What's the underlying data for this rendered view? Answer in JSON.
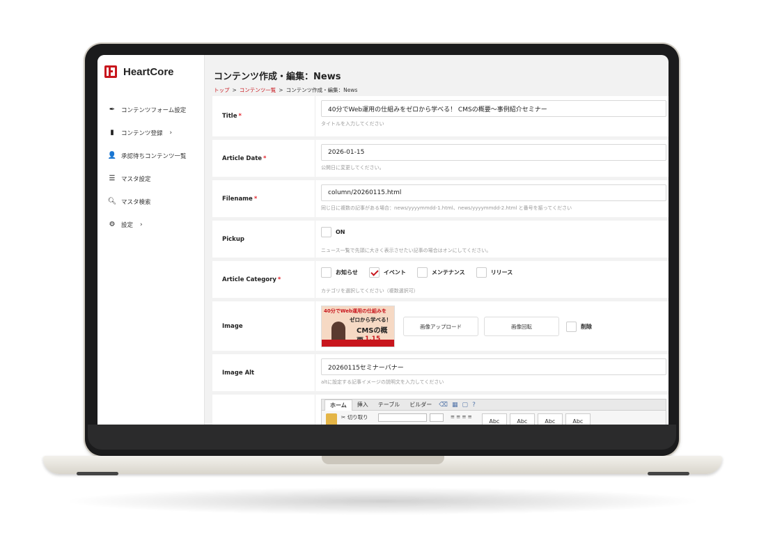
{
  "app": {
    "name": "HeartCore"
  },
  "sidebar": {
    "items": [
      {
        "icon": "pen-icon",
        "label": "コンテンツフォーム設定",
        "chevron": ""
      },
      {
        "icon": "file-icon",
        "label": "コンテンツ登録",
        "chevron": "›"
      },
      {
        "icon": "user-check-icon",
        "label": "承認待ちコンテンツ一覧",
        "chevron": ""
      },
      {
        "icon": "database-icon",
        "label": "マスタ設定",
        "chevron": ""
      },
      {
        "icon": "search-icon",
        "label": "マスタ検索",
        "chevron": ""
      },
      {
        "icon": "gear-icon",
        "label": "設定",
        "chevron": "›"
      }
    ]
  },
  "header": {
    "title": "コンテンツ作成・編集：News",
    "breadcrumb": {
      "home": "トップ",
      "sep": ">",
      "list": "コンテンツ一覧",
      "current": "コンテンツ作成・編集：News"
    }
  },
  "form": {
    "required_mark": "*",
    "title": {
      "label": "Title",
      "value": "40分でWeb運用の仕組みをゼロから学べる！ CMSの概要〜事例紹介セミナー",
      "help": "タイトルを入力してください"
    },
    "article_date": {
      "label": "Article Date",
      "value": "2026-01-15",
      "help": "公開日に変更してください。"
    },
    "filename": {
      "label": "Filename",
      "value": "column/20260115.html",
      "help": "同じ日に複数の記事がある場合：news/yyyymmdd-1.html、news/yyyymmdd-2.html と番号を振ってください"
    },
    "pickup": {
      "label": "Pickup",
      "option": "ON",
      "checked": false,
      "help": "ニュース一覧で先頭に大きく表示させたい記事の場合はオンにしてください。"
    },
    "category": {
      "label": "Article Category",
      "options": [
        {
          "label": "お知らせ",
          "checked": false
        },
        {
          "label": "イベント",
          "checked": true
        },
        {
          "label": "メンテナンス",
          "checked": false
        },
        {
          "label": "リリース",
          "checked": false
        }
      ],
      "help": "カテゴリを選択してください（複数選択可）"
    },
    "image": {
      "label": "Image",
      "thumb": {
        "line1": "40分でWeb運用の仕組みを",
        "line2": "ゼロから学べる！",
        "line3": "CMSの概要",
        "date": "1.15"
      },
      "upload_label": "画像アップロード",
      "rotate_label": "画像回転",
      "delete_label": "削除"
    },
    "image_alt": {
      "label": "Image Alt",
      "value": "20260115セミナーバナー",
      "help": "altに設定する記事イメージの説明文を入力してください"
    }
  },
  "editor": {
    "tabs": [
      "ホーム",
      "挿入",
      "テーブル",
      "ビルダー"
    ],
    "cut_label": "切り取り",
    "style_samples": [
      "Abc",
      "Abc",
      "Abc",
      "Abc"
    ]
  }
}
